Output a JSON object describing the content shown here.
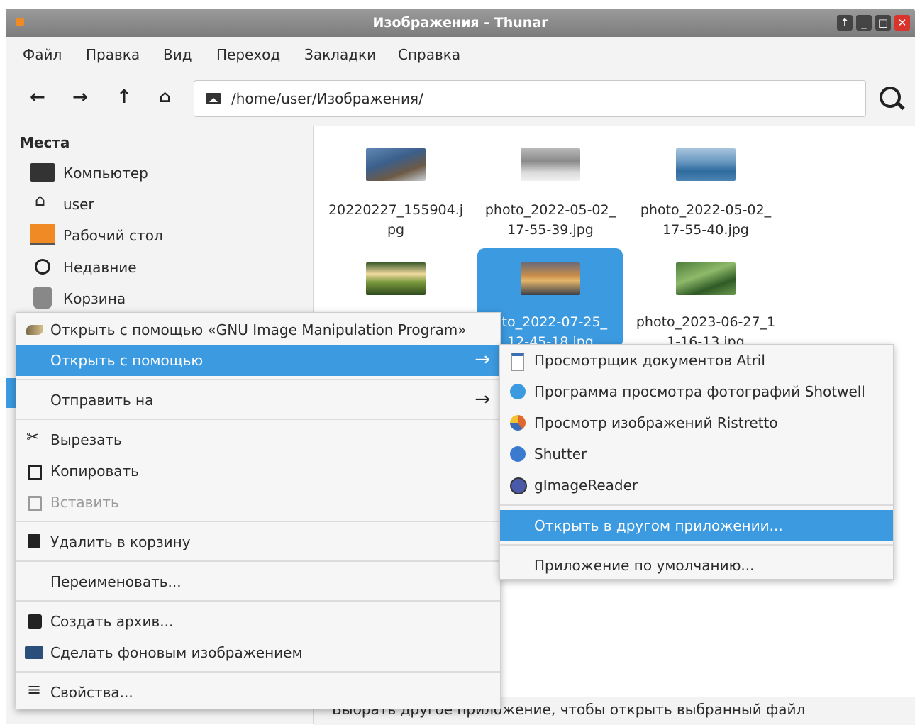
{
  "window": {
    "title": "Изображения - Thunar"
  },
  "menubar": [
    "Файл",
    "Правка",
    "Вид",
    "Переход",
    "Закладки",
    "Справка"
  ],
  "toolbar": {
    "path": "/home/user/Изображения/"
  },
  "sidebar": {
    "heading": "Места",
    "items": [
      {
        "label": "Компьютер",
        "icon": "computer-icon"
      },
      {
        "label": "user",
        "icon": "home-icon"
      },
      {
        "label": "Рабочий стол",
        "icon": "desktop-icon"
      },
      {
        "label": "Недавние",
        "icon": "clock-icon"
      },
      {
        "label": "Корзина",
        "icon": "trash-icon"
      }
    ]
  },
  "files": [
    {
      "name_line1": "20220227_155904.j",
      "name_line2": "pg"
    },
    {
      "name_line1": "photo_2022-05-02_",
      "name_line2": "17-55-39.jpg"
    },
    {
      "name_line1": "photo_2022-05-02_",
      "name_line2": "17-55-40.jpg"
    },
    {
      "name_line1": "",
      "name_line2": ""
    },
    {
      "name_line1": "oto_2022-07-25_",
      "name_line2": "12-45-18.jpg"
    },
    {
      "name_line1": "photo_2023-06-27_1",
      "name_line2": "1-16-13.jpg"
    }
  ],
  "context_menu": {
    "open_with_gimp": "Открыть с помощью «GNU Image Manipulation Program»",
    "open_with": "Открыть с помощью",
    "send_to": "Отправить на",
    "cut": "Вырезать",
    "copy": "Копировать",
    "paste": "Вставить",
    "trash": "Удалить в корзину",
    "rename": "Переименовать...",
    "archive": "Создать архив...",
    "wallpaper": "Сделать фоновым изображением",
    "properties": "Свойства..."
  },
  "submenu": {
    "atril": "Просмотрщик документов Atril",
    "shotwell": "Программа просмотра фотографий Shotwell",
    "ristretto": "Просмотр изображений Ristretto",
    "shutter": "Shutter",
    "gimagereader": "gImageReader",
    "other_app": "Открыть в другом приложении...",
    "default_app": "Приложение по умолчанию..."
  },
  "statusbar": {
    "text": "Выбрать другое приложение, чтобы открыть выбранный файл"
  },
  "colors": {
    "accent": "#3c9ae0",
    "titlebar": "#8a8a8a",
    "close": "#d9342b"
  }
}
